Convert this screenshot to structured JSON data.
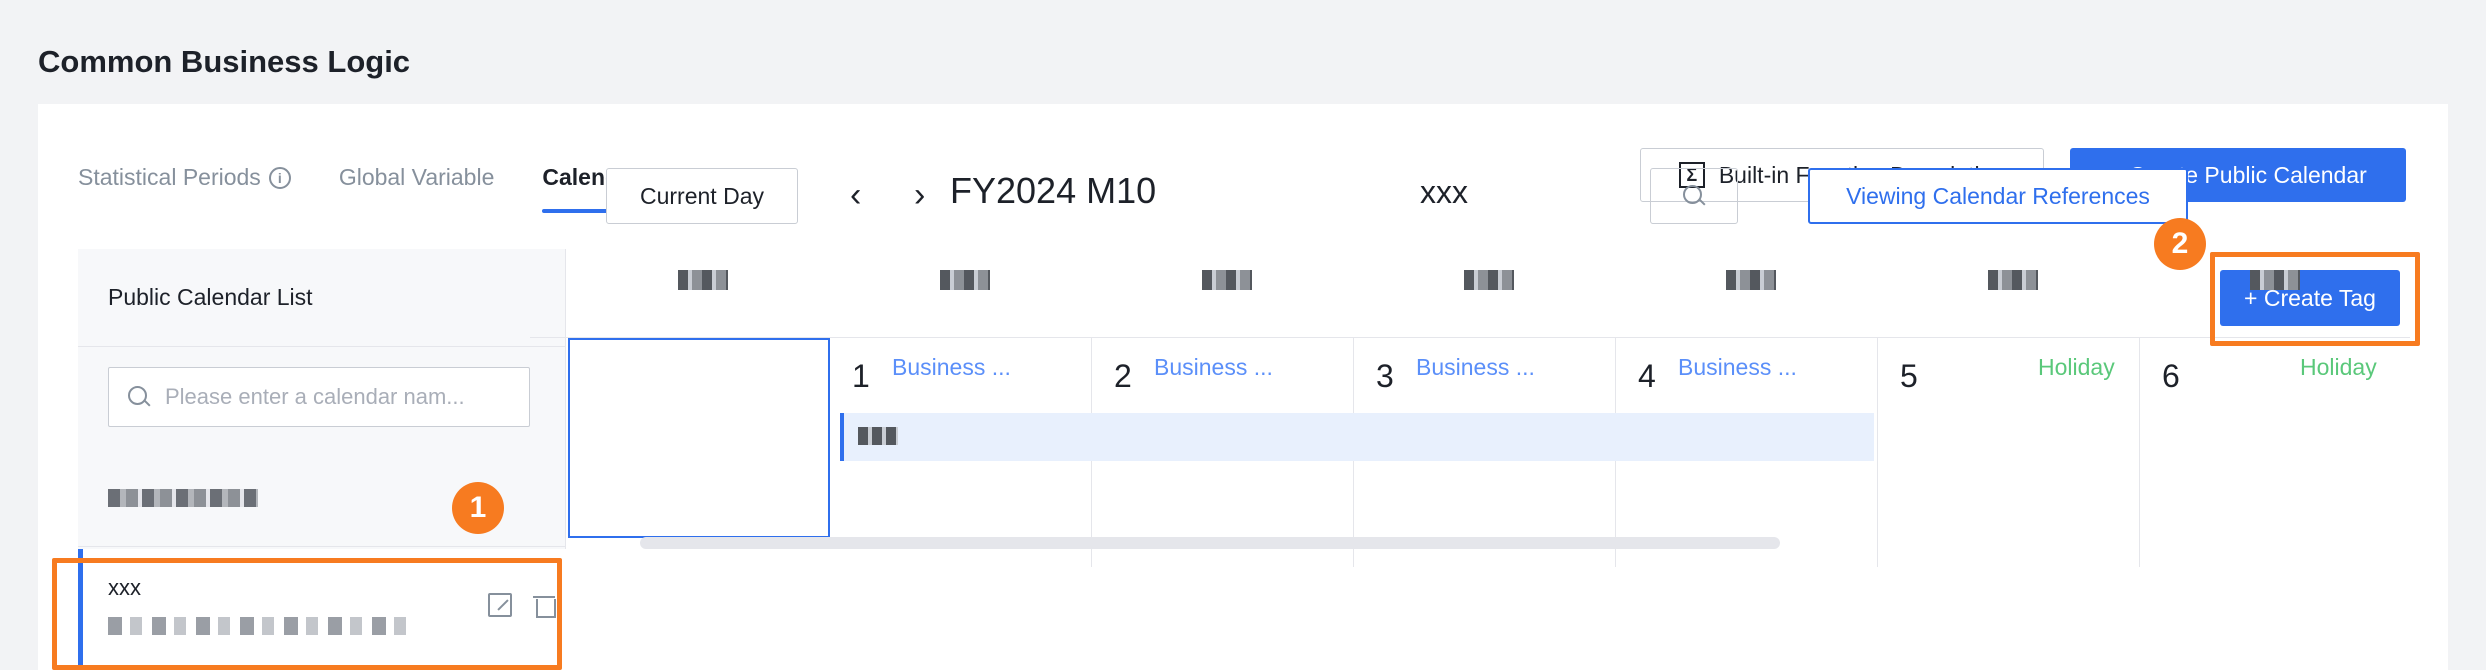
{
  "page": {
    "title": "Common Business Logic"
  },
  "tabs": [
    {
      "label": "Statistical Periods",
      "active": false
    },
    {
      "label": "Global Variable",
      "active": false
    },
    {
      "label": "Calendar",
      "active": true
    }
  ],
  "header_buttons": {
    "builtin_label": "Built-in Function Description",
    "create_public_label": "+ Create Public Calendar"
  },
  "sidebar": {
    "title": "Public Calendar List",
    "search_placeholder": "Please enter a calendar nam...",
    "items": [
      {
        "name": ""
      },
      {
        "name": "xxx"
      }
    ]
  },
  "calendar": {
    "current_day_label": "Current Day",
    "prev_icon": "chevron-left-icon",
    "next_icon": "chevron-right-icon",
    "period": "FY2024 M10",
    "name": "xxx",
    "references_label": "Viewing Calendar References",
    "create_tag_label": "+ Create Tag",
    "days": [
      {
        "num": "",
        "tag": "",
        "tag_type": ""
      },
      {
        "num": "1",
        "tag": "Business ...",
        "tag_type": "biz"
      },
      {
        "num": "2",
        "tag": "Business ...",
        "tag_type": "biz"
      },
      {
        "num": "3",
        "tag": "Business ...",
        "tag_type": "biz"
      },
      {
        "num": "4",
        "tag": "Business ...",
        "tag_type": "biz"
      },
      {
        "num": "5",
        "tag": "Holiday",
        "tag_type": "hol"
      },
      {
        "num": "6",
        "tag": "Holiday",
        "tag_type": "hol"
      }
    ]
  },
  "annotations": {
    "step1": "1",
    "step2": "2"
  },
  "colors": {
    "accent": "#2f6fed",
    "highlight": "#f77b20",
    "business": "#5b8ff9",
    "holiday": "#5ac87a"
  }
}
